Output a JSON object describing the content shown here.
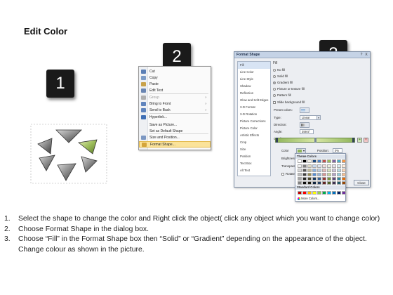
{
  "title": "Edit Color",
  "step_badges": [
    "1",
    "2",
    "3"
  ],
  "context_menu": {
    "items": [
      {
        "label": "Cut",
        "icon": "scissors-icon",
        "color": "#5b7fb5",
        "state": "normal"
      },
      {
        "label": "Copy",
        "icon": "copy-icon",
        "color": "#7d9cc7",
        "state": "normal"
      },
      {
        "label": "Paste",
        "icon": "clipboard-icon",
        "color": "#c8a24a",
        "state": "normal"
      },
      {
        "label": "Edit Text",
        "icon": "text-icon",
        "color": "#6a86b3",
        "state": "normal"
      },
      {
        "label": "Group",
        "icon": "group-icon",
        "color": "#b0b0b0",
        "state": "disabled",
        "submenu": true
      },
      {
        "label": "Bring to Front",
        "icon": "bring-front-icon",
        "color": "#5f84bd",
        "state": "normal",
        "submenu": true
      },
      {
        "label": "Send to Back",
        "icon": "send-back-icon",
        "color": "#5f84bd",
        "state": "normal",
        "submenu": true
      },
      {
        "label": "Hyperlink...",
        "icon": "hyperlink-icon",
        "color": "#3f6fb5",
        "state": "normal"
      },
      {
        "label": "Save as Picture...",
        "icon": "",
        "color": "",
        "state": "normal"
      },
      {
        "label": "Set as Default Shape",
        "icon": "",
        "color": "",
        "state": "normal"
      },
      {
        "label": "Size and Position...",
        "icon": "size-icon",
        "color": "#7b97c2",
        "state": "normal"
      },
      {
        "label": "Format Shape...",
        "icon": "format-shape-icon",
        "color": "#d4a53c",
        "state": "highlighted"
      }
    ]
  },
  "dialog": {
    "title": "Format Shape",
    "help_glyph": "?",
    "close_glyph": "X",
    "categories": [
      "Fill",
      "Line Color",
      "Line Style",
      "Shadow",
      "Reflection",
      "Glow and Soft Edges",
      "3-D Format",
      "3-D Rotation",
      "Picture Corrections",
      "Picture Color",
      "Artistic Effects",
      "Crop",
      "Size",
      "Position",
      "Text Box",
      "Alt Text"
    ],
    "selected_category": "Fill",
    "fill_heading": "Fill",
    "fill_options": [
      {
        "label": "No fill",
        "checked": false
      },
      {
        "label": "Solid fill",
        "checked": false
      },
      {
        "label": "Gradient fill",
        "checked": true
      },
      {
        "label": "Picture or texture fill",
        "checked": false
      },
      {
        "label": "Pattern fill",
        "checked": false
      }
    ],
    "slide_background_label": "Slide background fill",
    "preset_colors_label": "Preset colors:",
    "type_label": "Type:",
    "type_value": "Linear",
    "direction_label": "Direction:",
    "angle_label": "Angle:",
    "angle_value": "359.5°",
    "gradient_stops_label": "Gradient stops",
    "color_label": "Color",
    "position_label": "Position:",
    "position_value": "0%",
    "brightness_label": "Brightness:",
    "transparency_label": "Transparency:",
    "rotate_label": "Rotate",
    "close_label": "Close"
  },
  "color_popup": {
    "theme_header": "Theme Colors",
    "standard_header": "Standard Colors",
    "more_label": "More Colors...",
    "theme_top": [
      "#ffffff",
      "#000000",
      "#eeece1",
      "#1f497d",
      "#4f81bd",
      "#c0504d",
      "#9bbb59",
      "#8064a2",
      "#4bacc6",
      "#f79646"
    ],
    "theme_shades": [
      [
        "#f2f2f2",
        "#7f7f7f",
        "#ddd9c3",
        "#c6d9f0",
        "#dbe5f1",
        "#f2dcdb",
        "#ebf1dd",
        "#e5e0ec",
        "#dbeef3",
        "#fdeada"
      ],
      [
        "#d8d8d8",
        "#595959",
        "#c4bd97",
        "#8db3e2",
        "#b8cce4",
        "#e5b9b7",
        "#d7e3bc",
        "#ccc1d9",
        "#b7dde8",
        "#fbd5b5"
      ],
      [
        "#bfbfbf",
        "#3f3f3f",
        "#938953",
        "#548dd4",
        "#95b3d7",
        "#d99694",
        "#c3d69b",
        "#b2a2c7",
        "#92cddc",
        "#fac08f"
      ],
      [
        "#a5a5a5",
        "#262626",
        "#494429",
        "#17365d",
        "#366092",
        "#953734",
        "#76923c",
        "#5f497a",
        "#31859b",
        "#e36c09"
      ],
      [
        "#7f7f7f",
        "#0c0c0c",
        "#1d1b10",
        "#0f243e",
        "#244061",
        "#632423",
        "#4f6128",
        "#3f3151",
        "#205867",
        "#974806"
      ]
    ],
    "standard": [
      "#c00000",
      "#ff0000",
      "#ffc000",
      "#ffff00",
      "#92d050",
      "#00b050",
      "#00b0f0",
      "#0070c0",
      "#002060",
      "#7030a0"
    ]
  },
  "instructions": [
    {
      "num": "1.",
      "text": "Select the shape to change the color and Right click the object( click any object which you want to change color)"
    },
    {
      "num": "2.",
      "text": "Choose Format Shape in the dialog box."
    },
    {
      "num": "3.",
      "text": "Choose “Fill” in the Format Shape box then “Solid” or “Gradient” depending on the appearance of the object. Change colour as shown in the picture."
    }
  ]
}
